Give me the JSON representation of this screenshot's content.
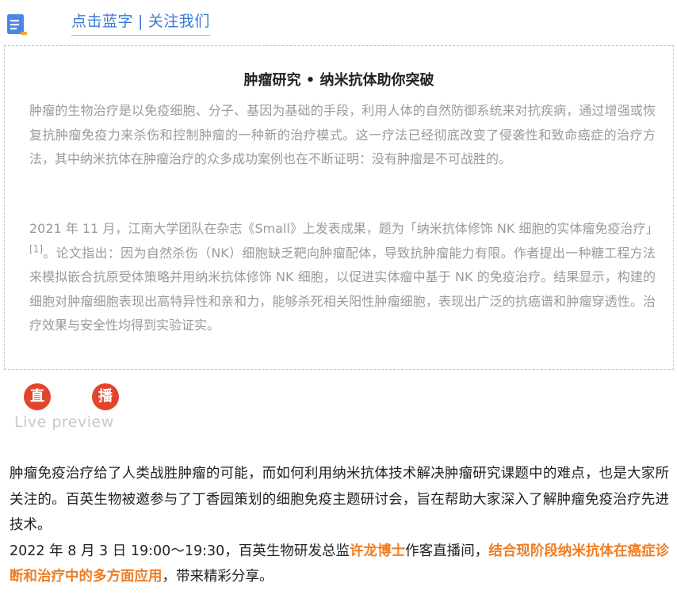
{
  "header": {
    "follow_link_part1": "点击蓝字",
    "separator": "|",
    "follow_link_part2": "关注我们"
  },
  "article": {
    "title": "肿瘤研究 • 纳米抗体助你突破",
    "paragraph1": "肿瘤的生物治疗是以免疫细胞、分子、基因为基础的手段，利用人体的自然防御系统来对抗疾病，通过增强或恢复抗肿瘤免疫力来杀伤和控制肿瘤的一种新的治疗模式。这一疗法已经彻底改变了侵袭性和致命癌症的治疗方法，其中纳米抗体在肿瘤治疗的众多成功案例也在不断证明：没有肿瘤是不可战胜的。",
    "paragraph2_part1": "2021 年 11 月，江南大学团队在杂志《Small》上发表成果，题为「纳米抗体修饰 NK 细胞的实体瘤免疫治疗」",
    "paragraph2_ref": "[1]",
    "paragraph2_part2": "。论文指出：因为自然杀伤（NK）细胞缺乏靶向肿瘤配体，导致抗肿瘤能力有限。作者提出一种糖工程方法来模拟嵌合抗原受体策略并用纳米抗体修饰 NK 细胞，以促进实体瘤中基于 NK 的免疫治疗。结果显示，构建的细胞对肿瘤细胞表现出高特异性和亲和力，能够杀死相关阳性肿瘤细胞，表现出广泛的抗癌谱和肿瘤穿透性。治疗效果与安全性均得到实验证实。"
  },
  "live": {
    "badge1": "直",
    "badge2": "播",
    "preview_label": "Live preview"
  },
  "intro": {
    "line1": "肿瘤免疫治疗给了人类战胜肿瘤的可能，而如何利用纳米抗体技术解决肿瘤研究课题中的难点，也是大家所关注的。百英生物被邀参与了丁香园策划的细胞免疫主题研讨会，旨在帮助大家深入了解肿瘤免疫治疗先进技术。",
    "line2_prefix": "2022 年 8 月 3 日 19:00～19:30，百英生物研发总监",
    "speaker": "许龙博士",
    "line2_mid": "作客直播间，",
    "topic": "结合现阶段纳米抗体在癌症诊断和治疗中的多方面应用",
    "line2_suffix": "，带来精彩分享。"
  },
  "colors": {
    "link_blue": "#3a7bd5",
    "badge_red": "#e2452c",
    "highlight_orange": "#f07d22",
    "muted_text": "#9a9a9a"
  },
  "icons": {
    "header_icon": "document-bookmark-icon"
  }
}
